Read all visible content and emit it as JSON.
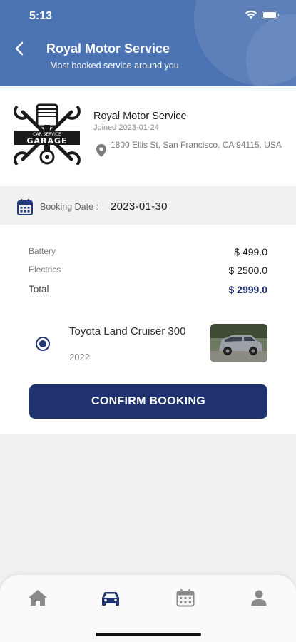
{
  "status_bar": {
    "time": "5:13"
  },
  "header": {
    "title": "Royal Motor Service",
    "subtitle": "Most booked service around you"
  },
  "garage": {
    "logo_text_top": "CAR SERVICE",
    "logo_text_main": "GARAGE",
    "name": "Royal Motor Service",
    "joined": "Joined 2023-01-24",
    "address": "1800 Ellis St, San Francisco, CA 94115, USA"
  },
  "booking": {
    "date_label": "Booking Date :",
    "date_value": "2023-01-30"
  },
  "services": [
    {
      "label": "Battery",
      "price": "$ 499.0"
    },
    {
      "label": "Electrics",
      "price": "$ 2500.0"
    }
  ],
  "total": {
    "label": "Total",
    "price": "$ 2999.0"
  },
  "vehicle": {
    "name": "Toyota Land Cruiser 300",
    "year": "2022",
    "selected": true
  },
  "confirm_button": "CONFIRM BOOKING",
  "tabs": [
    {
      "icon": "home-icon",
      "active": false
    },
    {
      "icon": "car-icon",
      "active": true
    },
    {
      "icon": "calendar-icon",
      "active": false
    },
    {
      "icon": "profile-icon",
      "active": false
    }
  ],
  "colors": {
    "header_bg": "#4b72b2",
    "primary": "#1f326f",
    "tab_inactive": "#8a8a8a"
  }
}
